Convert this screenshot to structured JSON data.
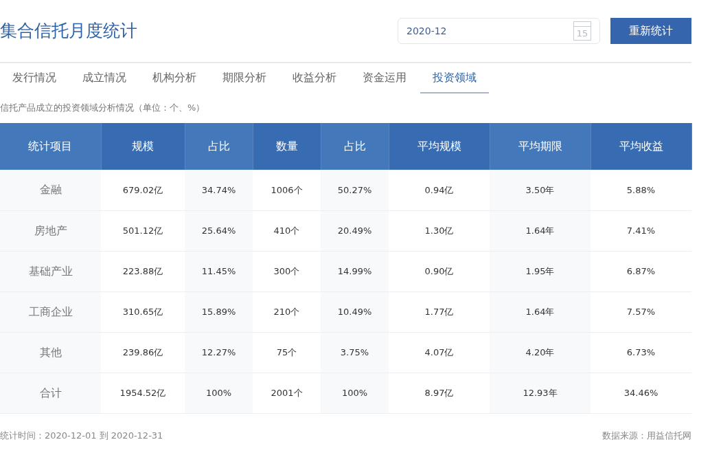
{
  "title": "集合信托月度统计",
  "date_field": {
    "value": "2020-12",
    "icon_text": "15"
  },
  "recount_button": "重新统计",
  "tabs": [
    {
      "label": "发行情况",
      "selected": false
    },
    {
      "label": "成立情况",
      "selected": false
    },
    {
      "label": "机构分析",
      "selected": false
    },
    {
      "label": "期限分析",
      "selected": false
    },
    {
      "label": "收益分析",
      "selected": false
    },
    {
      "label": "资金运用",
      "selected": false
    },
    {
      "label": "投资领域",
      "selected": true
    }
  ],
  "subtitle": "信托产品成立的投资领域分析情况（单位：个、%）",
  "table": {
    "columns": [
      "统计项目",
      "规模",
      "占比",
      "数量",
      "占比",
      "平均规模",
      "平均期限",
      "平均收益"
    ],
    "rows": [
      [
        "金融",
        "679.02亿",
        "34.74%",
        "1006个",
        "50.27%",
        "0.94亿",
        "3.50年",
        "5.88%"
      ],
      [
        "房地产",
        "501.12亿",
        "25.64%",
        "410个",
        "20.49%",
        "1.30亿",
        "1.64年",
        "7.41%"
      ],
      [
        "基础产业",
        "223.88亿",
        "11.45%",
        "300个",
        "14.99%",
        "0.90亿",
        "1.95年",
        "6.87%"
      ],
      [
        "工商企业",
        "310.65亿",
        "15.89%",
        "210个",
        "10.49%",
        "1.77亿",
        "1.64年",
        "7.57%"
      ],
      [
        "其他",
        "239.86亿",
        "12.27%",
        "75个",
        "3.75%",
        "4.07亿",
        "4.20年",
        "6.73%"
      ],
      [
        "合计",
        "1954.52亿",
        "100%",
        "2001个",
        "100%",
        "8.97亿",
        "12.93年",
        "34.46%"
      ]
    ]
  },
  "footer": {
    "period": "统计时间：2020-12-01 到 2020-12-31",
    "source": "数据来源：用益信托网"
  }
}
